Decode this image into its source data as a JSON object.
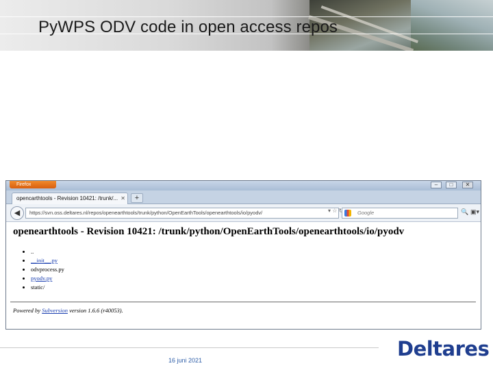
{
  "slide": {
    "title": "PyWPS ODV code in open access repos",
    "date": "16 juni 2021",
    "logo": "Deltares"
  },
  "browser": {
    "app_button": "Firefox",
    "window_title": "",
    "tab_title": "opencarthtools - Revision 10421: /trunk/...",
    "url": "https://svn.oss.deltares.nl/repos/openearthtools/trunk/python/OpenEarthTools/openearthtools/io/pyodv/",
    "search_placeholder": "Google",
    "page_heading": "openearthtools - Revision 10421: /trunk/python/OpenEarthTools/openearthtools/io/pyodv",
    "files": [
      {
        "label": "..",
        "link": false
      },
      {
        "label": "__init__.py",
        "link": true
      },
      {
        "label": "odvprocess.py",
        "link": false
      },
      {
        "label": "pyodv.py",
        "link": true
      },
      {
        "label": "static/",
        "link": false
      }
    ],
    "footer_prefix": "Powered by ",
    "footer_link": "Subversion",
    "footer_suffix": " version 1.6.6 (r40053)."
  }
}
